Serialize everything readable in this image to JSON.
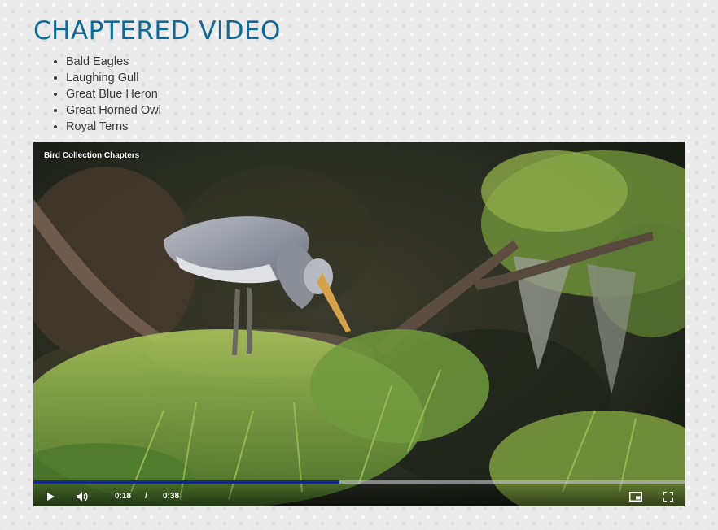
{
  "page": {
    "title": "CHAPTERED VIDEO",
    "chapters": [
      "Bald Eagles",
      "Laughing Gull",
      "Great Blue Heron",
      "Great Horned Owl",
      "Royal Terns"
    ]
  },
  "video": {
    "title": "Bird Collection Chapters",
    "current_time": "0:18",
    "separator": "/",
    "duration": "0:38",
    "progress_fraction": 0.47,
    "progress_color": "#14288c",
    "icons": {
      "play": "play-icon",
      "volume": "volume-icon",
      "pip": "picture-in-picture-icon",
      "fullscreen": "fullscreen-icon"
    }
  },
  "colors": {
    "title": "#0f6a96",
    "text": "#3a3a3a"
  }
}
